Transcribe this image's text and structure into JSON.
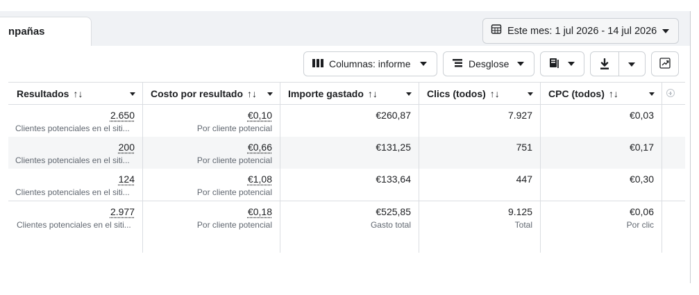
{
  "tabs": {
    "campaigns_label": "npañas"
  },
  "date_range": {
    "label": "Este mes: 1 jul 2026 - 14 jul 2026"
  },
  "toolbar": {
    "columns_label": "Columnas: informe",
    "breakdown_label": "Desglose"
  },
  "columns": [
    {
      "label": "Resultados",
      "sort": "↑↓"
    },
    {
      "label": "Costo por resultado",
      "sort": "↑↓"
    },
    {
      "label": "Importe gastado",
      "sort": "↑↓"
    },
    {
      "label": "Clics (todos)",
      "sort": "↑↓"
    },
    {
      "label": "CPC (todos)",
      "sort": "↑↓"
    }
  ],
  "rows": [
    {
      "results": "2.650",
      "results_sub": "Clientes potenciales en el siti...",
      "cpr": "€0,10",
      "cpr_sub": "Por cliente potencial",
      "spent": "€260,87",
      "clicks": "7.927",
      "cpc": "€0,03"
    },
    {
      "results": "200",
      "results_sub": "Clientes potenciales en el siti...",
      "cpr": "€0,66",
      "cpr_sub": "Por cliente potencial",
      "spent": "€131,25",
      "clicks": "751",
      "cpc": "€0,17"
    },
    {
      "results": "124",
      "results_sub": "Clientes potenciales en el siti...",
      "cpr": "€1,08",
      "cpr_sub": "Por cliente potencial",
      "spent": "€133,64",
      "clicks": "447",
      "cpc": "€0,30"
    }
  ],
  "totals": {
    "results": "2.977",
    "results_sub": "Clientes potenciales en el siti...",
    "cpr": "€0,18",
    "cpr_sub": "Por cliente potencial",
    "spent": "€525,85",
    "spent_sub": "Gasto total",
    "clicks": "9.125",
    "clicks_sub": "Total",
    "cpc": "€0,06",
    "cpc_sub": "Por clic"
  },
  "icons": {
    "calendar": "calendar-icon",
    "columns": "columns-icon",
    "breakdown": "breakdown-icon",
    "reports": "reports-icon",
    "export": "download-icon",
    "chart": "chart-trend-icon",
    "add_column": "add-column-icon"
  }
}
